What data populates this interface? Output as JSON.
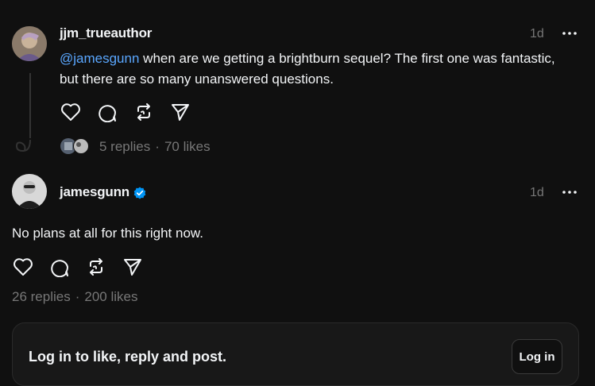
{
  "post1": {
    "username": "jjm_trueauthor",
    "time": "1d",
    "mention": "@jamesgunn",
    "text": " when are we getting a brightburn sequel? The first one was fantastic, but there are so many unanswered questions.",
    "replies": "5 replies",
    "likes": "70 likes",
    "sep": "·"
  },
  "post2": {
    "username": "jamesgunn",
    "time": "1d",
    "text": "No plans at all for this right now.",
    "replies": "26 replies",
    "likes": "200 likes",
    "sep": "·"
  },
  "login": {
    "prompt": "Log in to like, reply and post.",
    "button": "Log in"
  },
  "colors": {
    "background": "#101010",
    "mention": "#5aa7ff",
    "verified": "#0095f6",
    "muted": "#777777"
  }
}
